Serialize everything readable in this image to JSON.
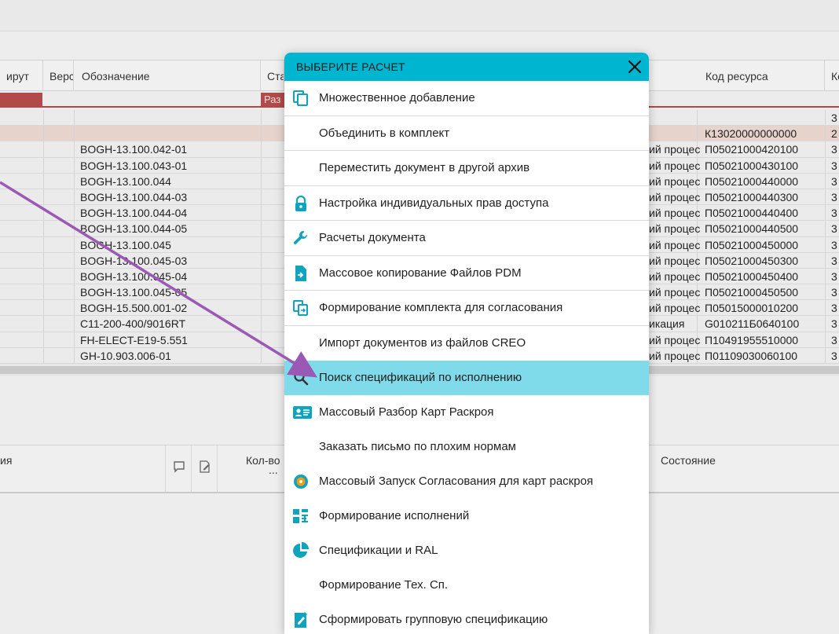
{
  "grid": {
    "headers": {
      "route": "ирут",
      "version": "Верс",
      "designation": "Обозначение",
      "status": "Ста",
      "resource_code": "Код ресурса",
      "extra": "Ко"
    },
    "filter_status": "Раз",
    "rows": [
      {
        "designation": "",
        "process": "",
        "code": "",
        "extra": "3"
      },
      {
        "designation": "",
        "process": "",
        "code": "К13020000000000",
        "extra": "2"
      },
      {
        "designation": "BOGH-13.100.042-01",
        "process": "ий процес",
        "code": "П05021000420100",
        "extra": "3"
      },
      {
        "designation": "BOGH-13.100.043-01",
        "process": "ий процес",
        "code": "П05021000430100",
        "extra": "3"
      },
      {
        "designation": "BOGH-13.100.044",
        "process": "ий процес",
        "code": "П05021000440000",
        "extra": "3"
      },
      {
        "designation": "BOGH-13.100.044-03",
        "process": "ий процес",
        "code": "П05021000440300",
        "extra": "3"
      },
      {
        "designation": "BOGH-13.100.044-04",
        "process": "ий процес",
        "code": "П05021000440400",
        "extra": "3"
      },
      {
        "designation": "BOGH-13.100.044-05",
        "process": "ий процес",
        "code": "П05021000440500",
        "extra": "3"
      },
      {
        "designation": "BOGH-13.100.045",
        "process": "ий процес",
        "code": "П05021000450000",
        "extra": "3"
      },
      {
        "designation": "BOGH-13.100.045-03",
        "process": "ий процес",
        "code": "П05021000450300",
        "extra": "3"
      },
      {
        "designation": "BOGH-13.100.045-04",
        "process": "ий процес",
        "code": "П05021000450400",
        "extra": "3"
      },
      {
        "designation": "BOGH-13.100.045-05",
        "process": "ий процес",
        "code": "П05021000450500",
        "extra": "3"
      },
      {
        "designation": "BOGH-15.500.001-02",
        "process": "ий процес",
        "code": "П05015000010200",
        "extra": "3"
      },
      {
        "designation": "C11-200-400/9016RT",
        "process": "икация",
        "code": "G010211Б0640100",
        "extra": "3"
      },
      {
        "designation": "FH-ELECT-E19-5.551",
        "process": "ий процес",
        "code": "П10491955510000",
        "extra": "3"
      },
      {
        "designation": "GH-10.903.006-01",
        "process": "ий процес",
        "code": "П01109030060100",
        "extra": "3"
      }
    ]
  },
  "lower_panel": {
    "col1": "ия",
    "qty": "Кол-во",
    "qty_more": "...",
    "state": "Состояние"
  },
  "dialog": {
    "title": "ВЫБЕРИТЕ РАСЧЕТ",
    "items": [
      {
        "label": "Множественное добавление",
        "icon": "copy-icon"
      },
      {
        "label": "Объединить в комплект",
        "icon": ""
      },
      {
        "label": "Переместить документ в другой архив",
        "icon": ""
      },
      {
        "label": "Настройка индивидуальных прав доступа",
        "icon": "lock-icon"
      },
      {
        "label": "Расчеты документа",
        "icon": "wrench-icon"
      },
      {
        "label": "Массовое копирование Файлов PDM",
        "icon": "file-import-icon"
      },
      {
        "label": "Формирование комплекта для согласования",
        "icon": "copy-transfer-icon"
      },
      {
        "label": "Импорт документов из файлов CREO",
        "icon": ""
      },
      {
        "label": "Поиск спецификаций по исполнению",
        "icon": "search-icon"
      },
      {
        "label": "Массовый Разбор Карт Раскроя",
        "icon": "id-card-icon"
      },
      {
        "label": "Заказать письмо по плохим нормам",
        "icon": ""
      },
      {
        "label": "Массовый Запуск Согласования для карт раскроя",
        "icon": "orange-badge-icon"
      },
      {
        "label": "Формирование исполнений",
        "icon": "layout-icon"
      },
      {
        "label": "Спецификации и RAL",
        "icon": "pie-chart-icon"
      },
      {
        "label": "Формирование Тех. Сп.",
        "icon": ""
      },
      {
        "label": "Сформировать групповую спецификацию",
        "icon": "edit-doc-icon"
      }
    ],
    "active_index": 8
  },
  "colors": {
    "accent": "#00b5cf",
    "active_item": "#7fdaea",
    "filter_red": "#b24a4a",
    "arrow": "#9b59b6"
  }
}
